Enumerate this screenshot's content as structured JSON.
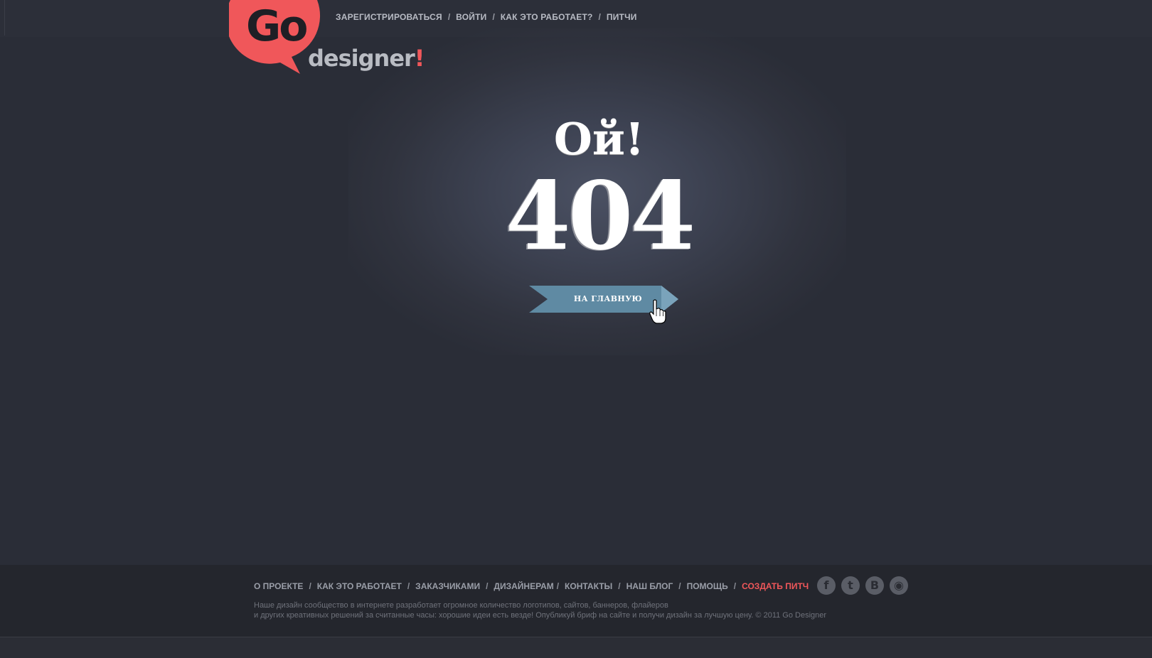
{
  "logo": {
    "go": "Go",
    "designer": "designer",
    "exclamation": "!"
  },
  "topnav": {
    "items": [
      {
        "label": "ЗАРЕГИСТРИРОВАТЬСЯ"
      },
      {
        "label": "ВОЙТИ"
      },
      {
        "label": "КАК ЭТО РАБОТАЕТ?"
      },
      {
        "label": "ПИТЧИ"
      }
    ],
    "separator": "/"
  },
  "error": {
    "oops": "Ой!",
    "code": "404",
    "home_button": "НА ГЛАВНУЮ"
  },
  "footer": {
    "nav": [
      {
        "label": "О ПРОЕКТЕ"
      },
      {
        "label": "КАК ЭТО РАБОТАЕТ"
      },
      {
        "label": "ЗАКАЗЧИКАМИ"
      },
      {
        "label": "ДИЗАЙНЕРАМ"
      },
      {
        "label": "КОНТАКТЫ"
      },
      {
        "label": "НАШ БЛОГ"
      },
      {
        "label": "ПОМОЩЬ"
      },
      {
        "label": "СОЗДАТЬ ПИТЧ"
      }
    ],
    "separator": "/",
    "text_line1": "Наше дизайн сообщество в интернете разработает огромное количество логотипов, сайтов, баннеров, флайеров",
    "text_line2": "и других креативных решений за считанные часы: хорошие идеи есть везде! Опубликуй бриф на сайте и получи дизайн за лучшую цену. © 2011 Go Designer",
    "social": [
      {
        "icon": "facebook-icon",
        "glyph": "f"
      },
      {
        "icon": "twitter-icon",
        "glyph": "t"
      },
      {
        "icon": "vkontakte-icon",
        "glyph": "B"
      },
      {
        "icon": "rss-icon",
        "glyph": "◉"
      }
    ]
  },
  "colors": {
    "background": "#2a2d37",
    "accent": "#f0575a",
    "button": "#5f8aa3",
    "footer": "#24262d"
  }
}
